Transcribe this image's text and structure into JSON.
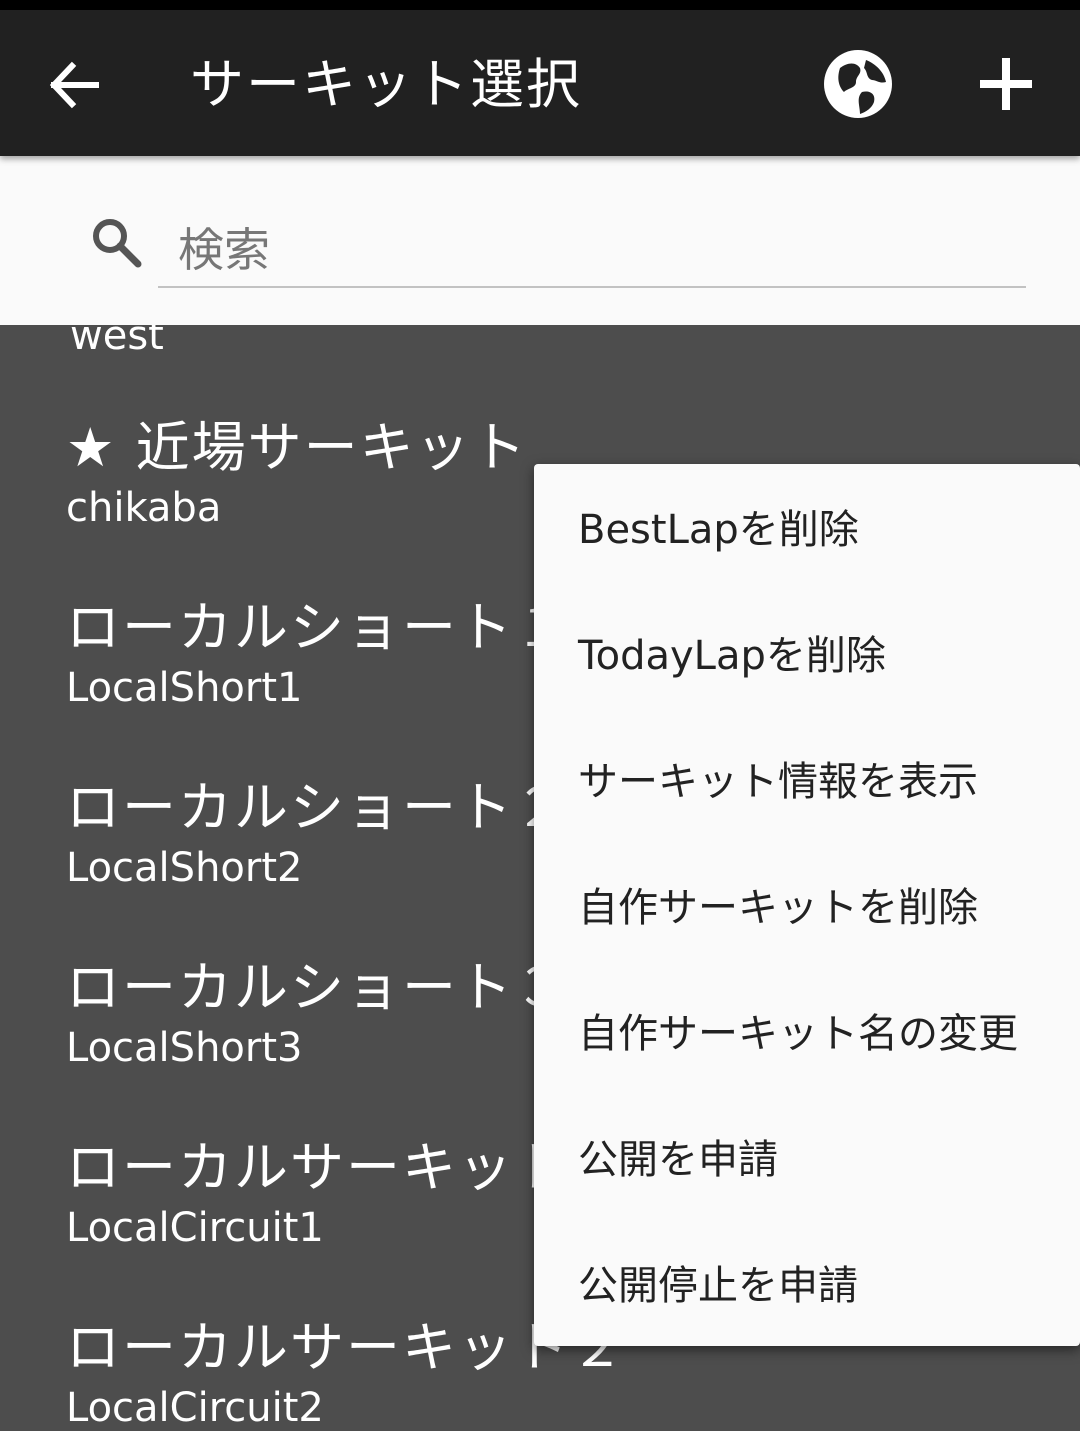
{
  "appbar": {
    "title": "サーキット選択",
    "icons": {
      "back": "arrow-back-icon",
      "globe": "globe-icon",
      "add": "plus-icon"
    }
  },
  "search": {
    "placeholder": "検索",
    "icon": "search-icon"
  },
  "list": {
    "partial_top": "west",
    "items": [
      {
        "name": "★ 近場サーキット",
        "id": "chikaba"
      },
      {
        "name": "ローカルショート１",
        "id": "LocalShort1"
      },
      {
        "name": "ローカルショート２",
        "id": "LocalShort2"
      },
      {
        "name": "ローカルショート３",
        "id": "LocalShort3"
      },
      {
        "name": "ローカルサーキット",
        "id": "LocalCircuit1"
      },
      {
        "name": "ローカルサーキット２",
        "id": "LocalCircuit2"
      }
    ]
  },
  "menu": {
    "items": [
      "BestLapを削除",
      "TodayLapを削除",
      "サーキット情報を表示",
      "自作サーキットを削除",
      "自作サーキット名の変更",
      "公開を申請",
      "公開停止を申請"
    ]
  },
  "colors": {
    "appbar": "#212121",
    "overlay_background": "#4d4d4d",
    "menu": "#fafafa"
  }
}
